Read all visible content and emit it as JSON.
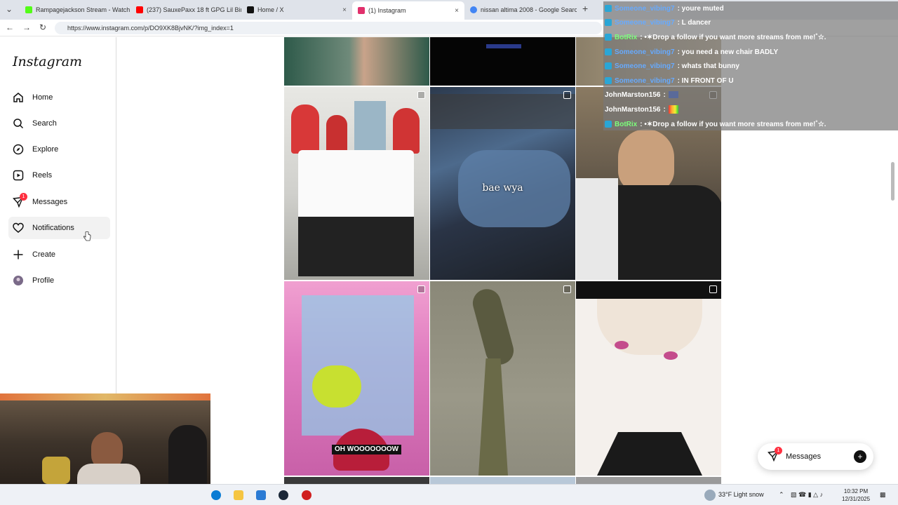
{
  "browser": {
    "tabs": [
      {
        "title": "Rampagejackson Stream - Watch",
        "color": "#53fc18"
      },
      {
        "title": "(237) SauxePaxx 18 ft GPG Lil Binn",
        "color": "#ff0000"
      },
      {
        "title": "Home / X",
        "color": "#111111"
      },
      {
        "title": "(1) Instagram",
        "color": "#e1306c"
      },
      {
        "title": "nissan altima 2008 - Google Search",
        "color": "#4285f4"
      }
    ],
    "url": "https://www.instagram.com/p/DO9XK8BjvNK/?img_index=1"
  },
  "sidebar": {
    "logo": "Instagram",
    "items": [
      {
        "label": "Home",
        "icon": "home-icon"
      },
      {
        "label": "Search",
        "icon": "search-icon"
      },
      {
        "label": "Explore",
        "icon": "compass-icon"
      },
      {
        "label": "Reels",
        "icon": "reels-icon"
      },
      {
        "label": "Messages",
        "icon": "messenger-icon",
        "badge": "1"
      },
      {
        "label": "Notifications",
        "icon": "heart-icon"
      },
      {
        "label": "Create",
        "icon": "plus-icon"
      },
      {
        "label": "Profile",
        "icon": "avatar-icon"
      }
    ]
  },
  "grid": {
    "captions": {
      "bae": "bae wya",
      "claw": "OH WOOOOOOOW"
    }
  },
  "chat": {
    "messages": [
      {
        "user": "Someone_vibing7",
        "text": ": youre muted",
        "kind": "user"
      },
      {
        "user": "Someone_vibing7",
        "text": ": L dancer",
        "kind": "user"
      },
      {
        "user": "BotRix",
        "text": ": •✶Drop a follow if you want more streams from me!˚☆.",
        "kind": "bot"
      },
      {
        "user": "Someone_vibing7",
        "text": ": you need a new chair BADLY",
        "kind": "user"
      },
      {
        "user": "Someone_vibing7",
        "text": ": whats that bunny",
        "kind": "user"
      },
      {
        "user": "Someone_vibing7",
        "text": ": IN FRONT OF U",
        "kind": "user"
      },
      {
        "user": "JohnMarston156",
        "text": ":",
        "kind": "plain"
      },
      {
        "user": "JohnMarston156",
        "text": ":",
        "kind": "plain"
      },
      {
        "user": "BotRix",
        "text": ": •✶Drop a follow if you want more streams from me!˚☆.",
        "kind": "bot"
      }
    ]
  },
  "messages_pill": {
    "label": "Messages",
    "badge": "1"
  },
  "taskbar": {
    "weather": "33°F  Light snow",
    "time": "10:32 PM",
    "date": "12/31/2025"
  }
}
